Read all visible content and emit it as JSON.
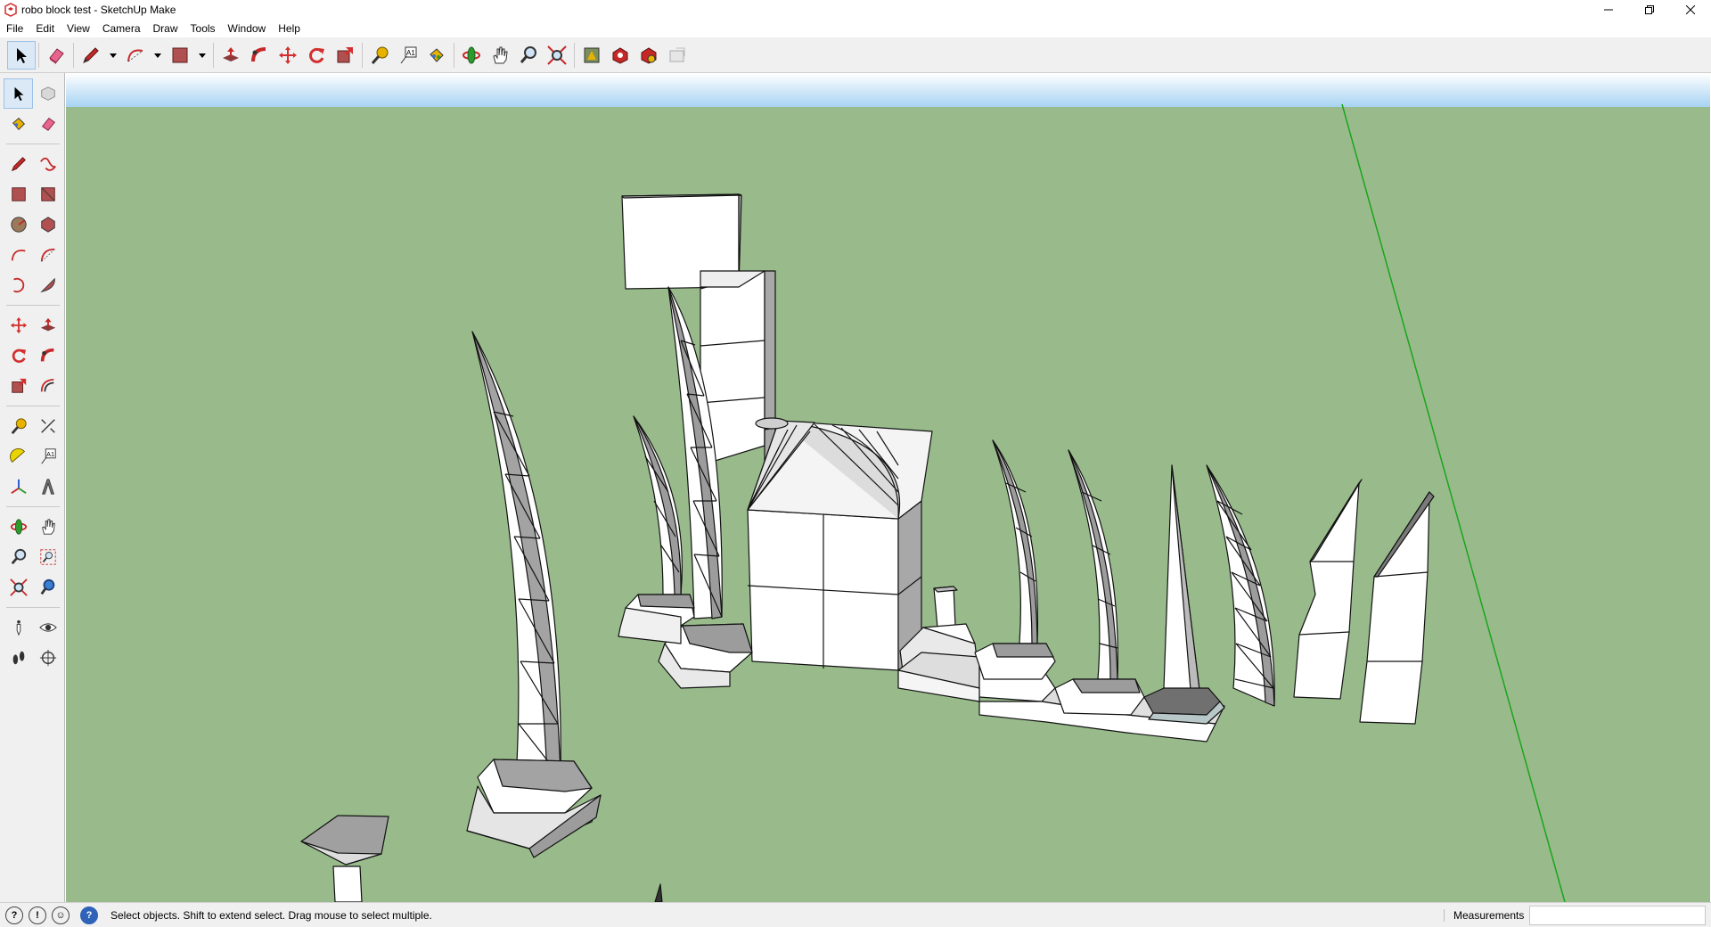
{
  "window": {
    "title": "robo block test - SketchUp Make",
    "controls": [
      "minimize-icon",
      "restore-icon",
      "close-icon"
    ]
  },
  "menu": [
    {
      "label": "File"
    },
    {
      "label": "Edit"
    },
    {
      "label": "View"
    },
    {
      "label": "Camera"
    },
    {
      "label": "Draw"
    },
    {
      "label": "Tools"
    },
    {
      "label": "Window"
    },
    {
      "label": "Help"
    }
  ],
  "toolbar": {
    "tools": [
      "select",
      "eraser",
      "line",
      "arc",
      "rectangle",
      "push-pull",
      "follow-me",
      "move",
      "rotate",
      "scale",
      "tape-measure",
      "text",
      "paint-bucket",
      "orbit",
      "pan",
      "zoom",
      "zoom-extents",
      "warehouse",
      "extension-warehouse",
      "layout",
      "send-to-layout"
    ]
  },
  "status": {
    "hint": "Select objects. Shift to extend select. Drag mouse to select multiple.",
    "measurements_label": "Measurements",
    "measurements_value": ""
  },
  "colors": {
    "ground": "#99bb8c",
    "sky_top": "#ffffff",
    "sky_bottom": "#a7d3f2",
    "green_axis": "#1aa51a",
    "face_light": "#ffffff",
    "face_dark": "#9e9e9e"
  }
}
